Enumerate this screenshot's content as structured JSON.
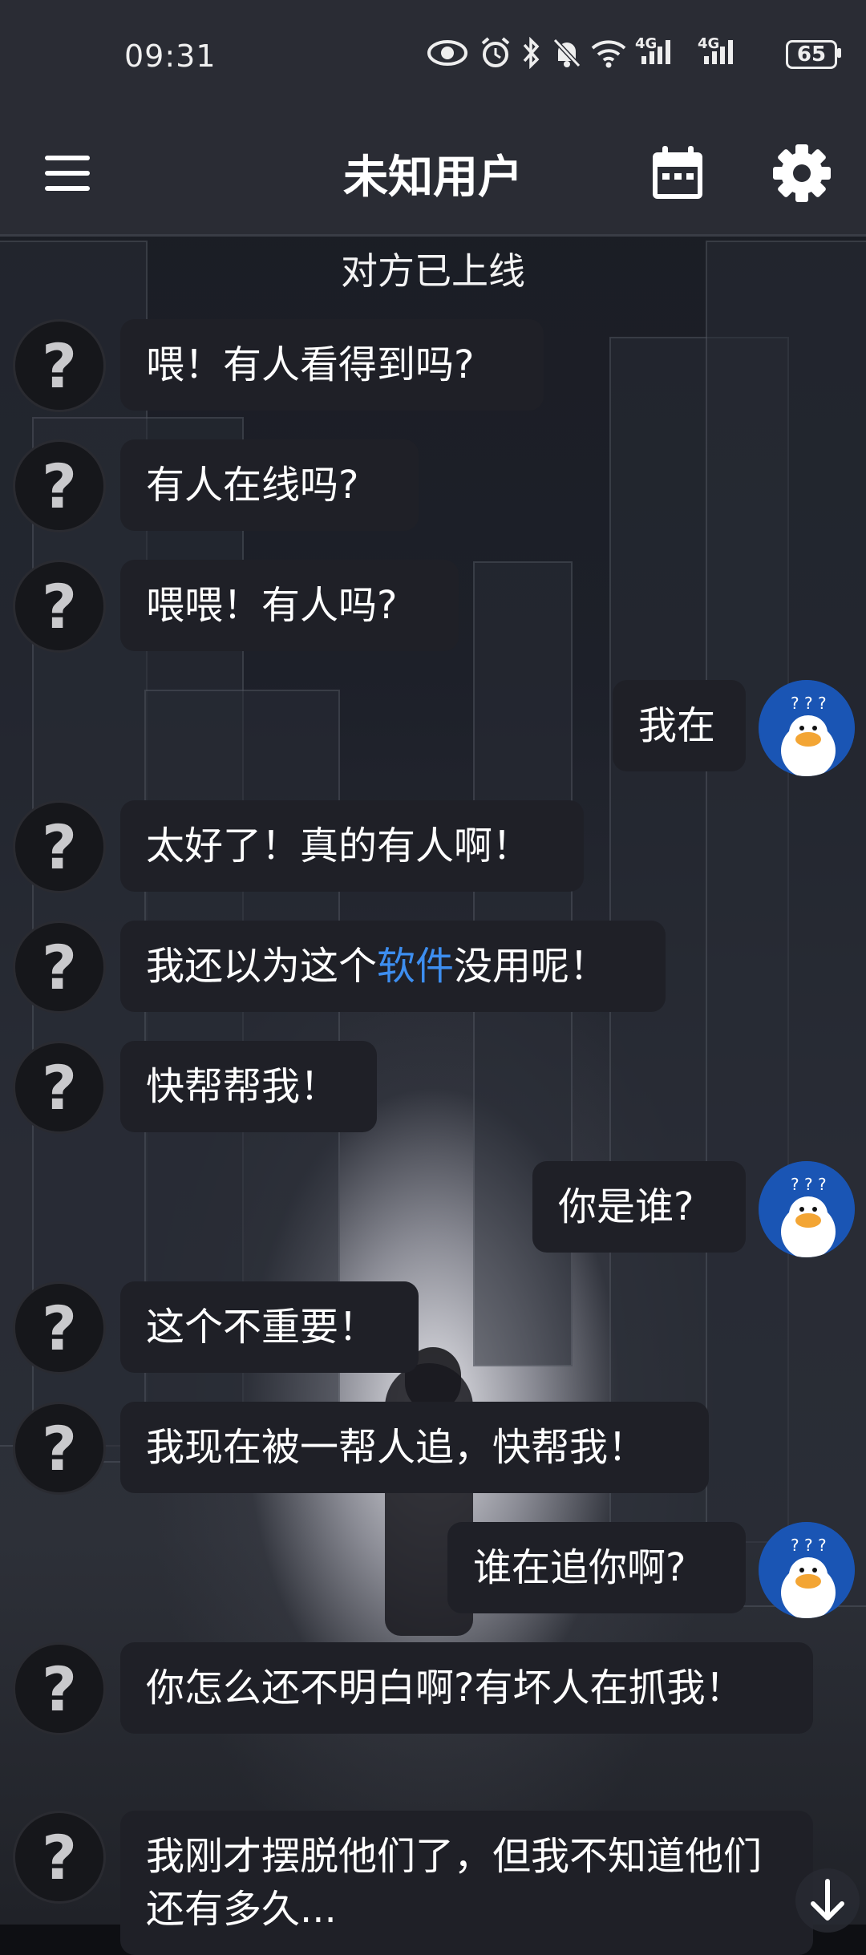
{
  "status_bar": {
    "time": "09:31",
    "net1": "4G",
    "net2": "4G",
    "battery": "65"
  },
  "header": {
    "title": "未知用户"
  },
  "system_message": "对方已上线",
  "avatar_glyph": "?",
  "messages": [
    {
      "from": "them",
      "text": "喂！有人看得到吗?"
    },
    {
      "from": "them",
      "text": "有人在线吗?"
    },
    {
      "from": "them",
      "text": "喂喂！有人吗?"
    },
    {
      "from": "me",
      "text": "我在"
    },
    {
      "from": "them",
      "text": "太好了！真的有人啊！"
    },
    {
      "from": "them",
      "text_before": "我还以为这个",
      "link": "软件",
      "text_after": "没用呢！"
    },
    {
      "from": "them",
      "text": "快帮帮我！"
    },
    {
      "from": "me",
      "text": "你是谁?"
    },
    {
      "from": "them",
      "text": "这个不重要！"
    },
    {
      "from": "them",
      "text": "我现在被一帮人追，快帮我！"
    },
    {
      "from": "me",
      "text": "谁在追你啊?"
    },
    {
      "from": "them",
      "text": "你怎么还不明白啊?有坏人在抓我！"
    },
    {
      "from": "them",
      "text": "我刚才摆脱他们了，但我不知道他们还有多久..."
    }
  ],
  "colors": {
    "bar_bg": "#2a2c34",
    "bubble_bg": "#1f2027",
    "link": "#3d8ef0",
    "duck_avatar_bg": "#1a55b4"
  },
  "icons": {
    "menu": "hamburger-menu-icon",
    "calendar": "calendar-icon",
    "settings": "gear-icon",
    "scroll": "arrow-down-icon"
  }
}
